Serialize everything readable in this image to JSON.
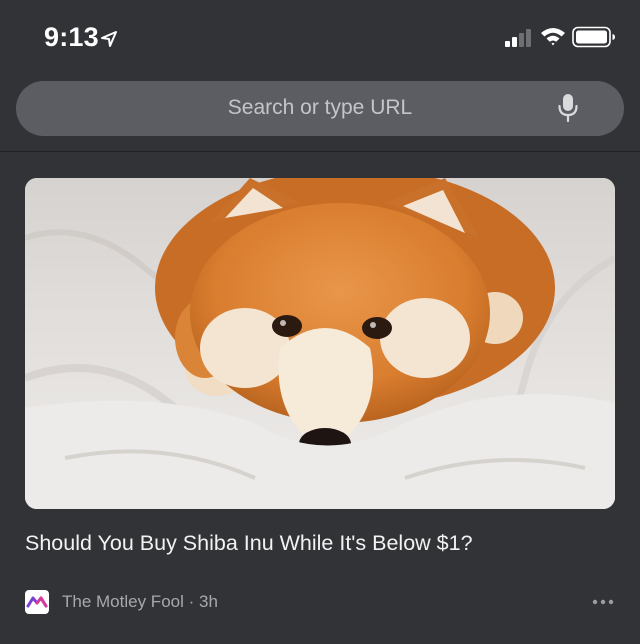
{
  "status_bar": {
    "time": "9:13",
    "icons": [
      "location-arrow-icon",
      "cellular-signal-icon",
      "wifi-icon",
      "battery-icon"
    ]
  },
  "search": {
    "placeholder": "Search or type URL",
    "mic_icon": "microphone-icon"
  },
  "article": {
    "image_icon": "shiba-inu-dog-photo",
    "title": "Should You Buy Shiba Inu While It's Below $1?",
    "source": "The Motley Fool · 3h",
    "source_logo_icon": "motley-fool-logo-icon",
    "more_icon": "more-options-icon"
  },
  "colors": {
    "background": "#323336",
    "search_bar": "#5b5d62",
    "placeholder_text": "#c4c5c8",
    "secondary_text": "#a7a8ab",
    "logo_accent": "#7b3fd6",
    "logo_accent_2": "#d63a9a"
  }
}
